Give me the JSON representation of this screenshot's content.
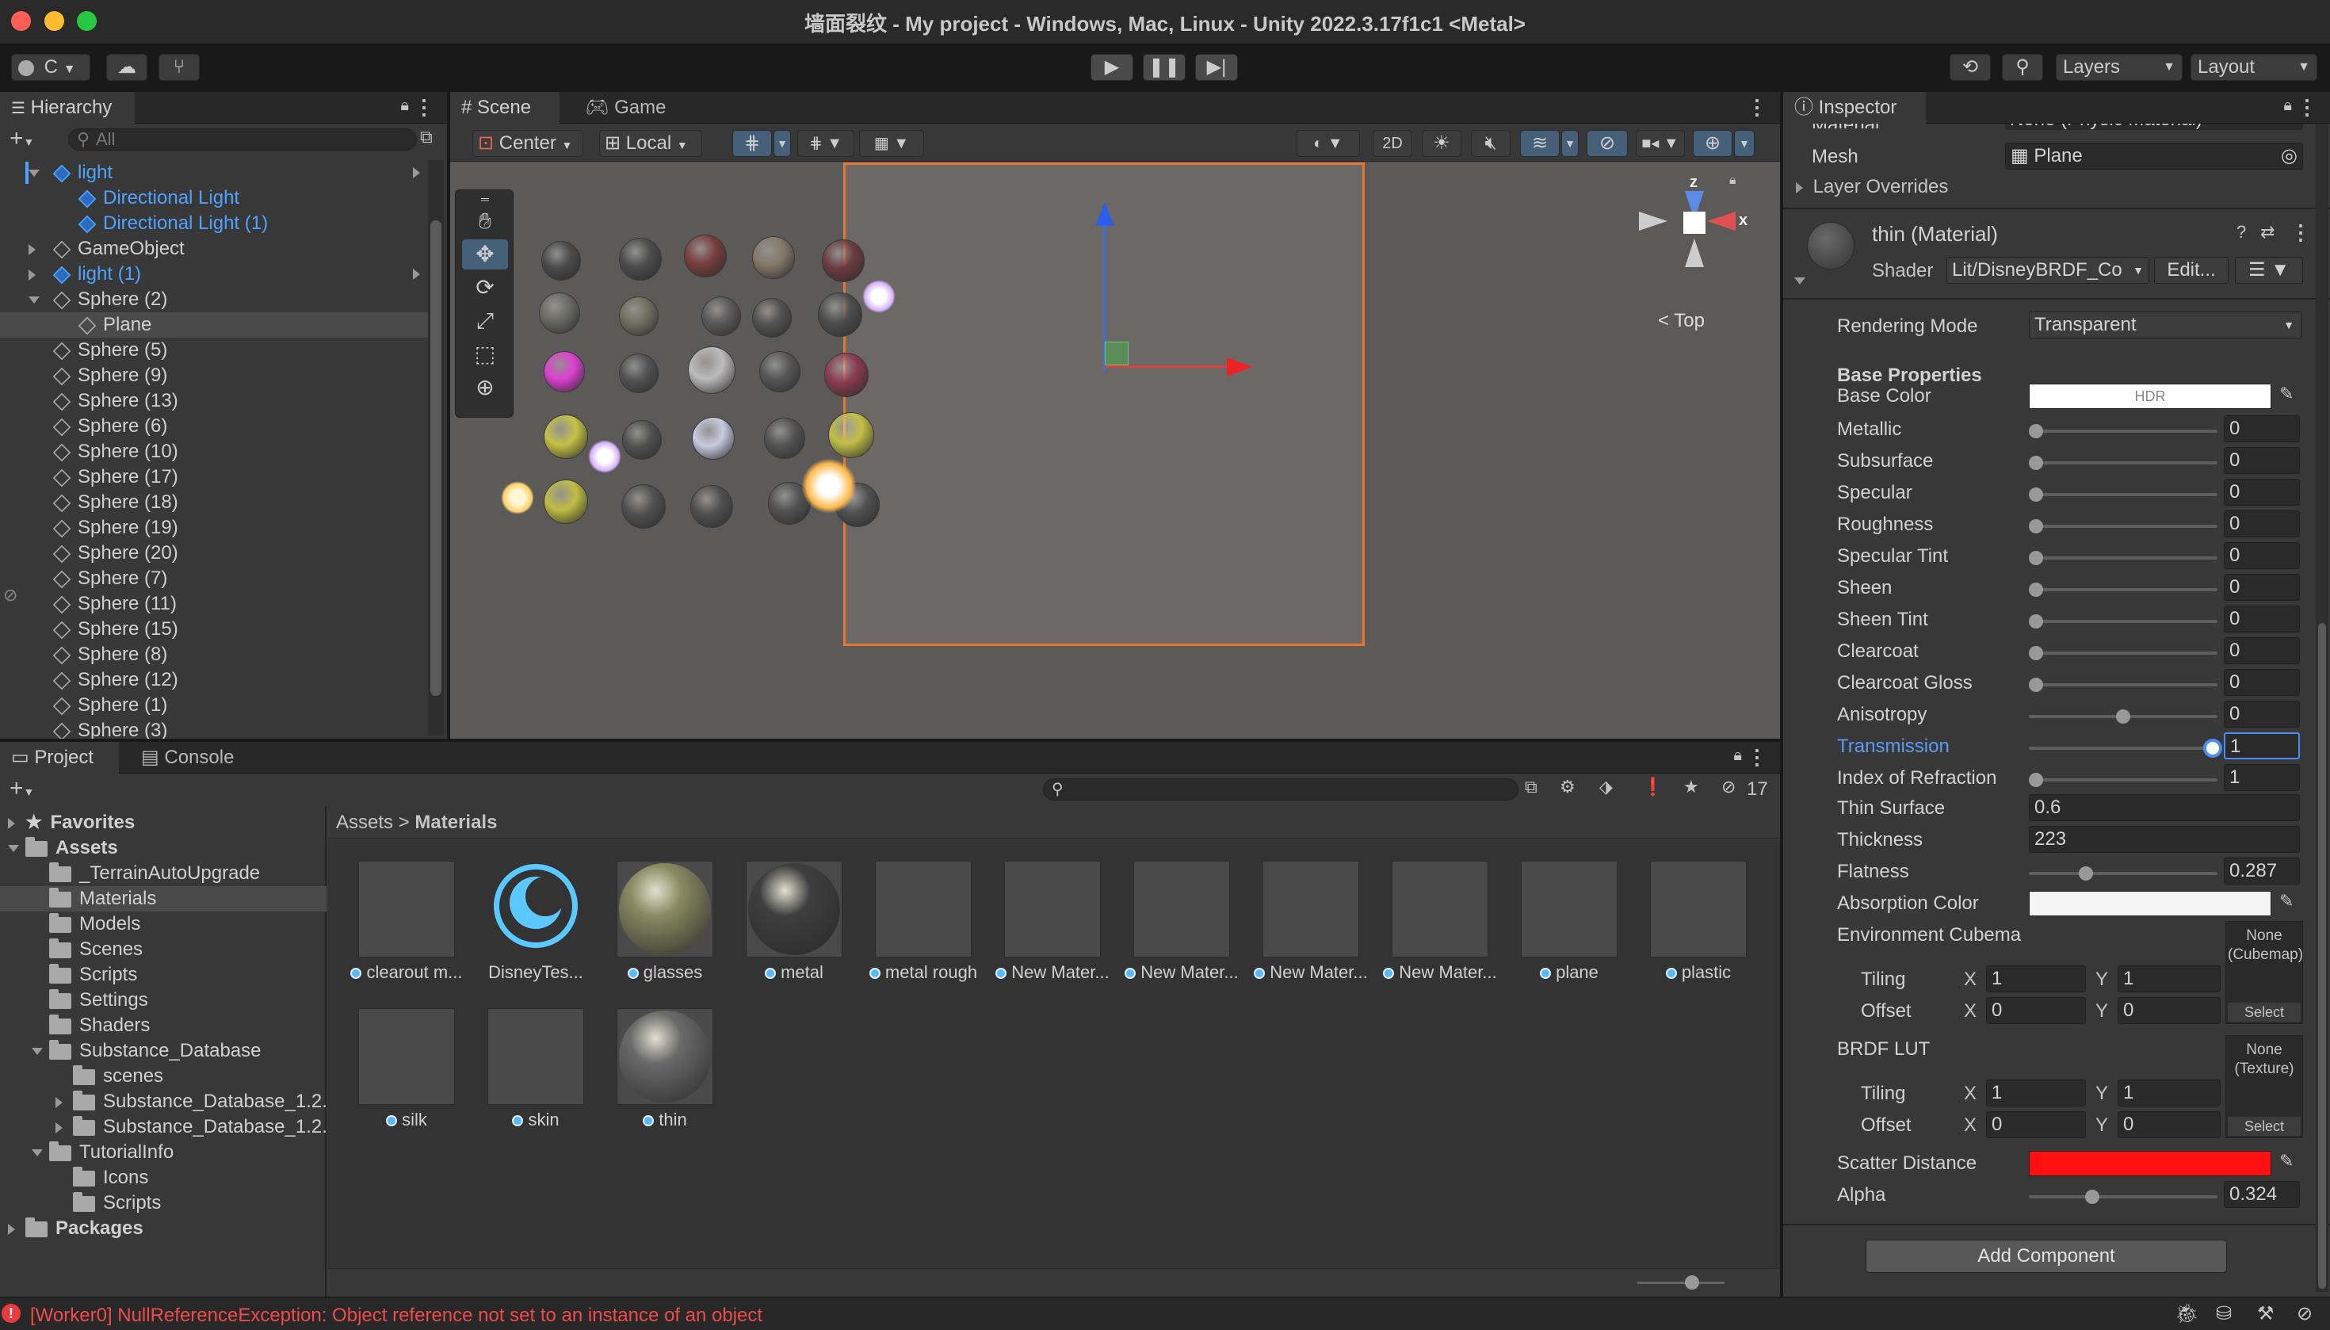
{
  "window": {
    "title": "墙面裂纹 - My project - Windows, Mac, Linux - Unity 2022.3.17f1c1 <Metal>"
  },
  "toolbar": {
    "account": "C",
    "layers": "Layers",
    "layout": "Layout"
  },
  "hierarchy": {
    "tab": "Hierarchy",
    "search_placeholder": "All",
    "items": [
      {
        "label": "light",
        "blue": true,
        "indent": 1,
        "arrow": "down"
      },
      {
        "label": "Directional Light",
        "blue": true,
        "indent": 2
      },
      {
        "label": "Directional Light (1)",
        "blue": true,
        "indent": 2
      },
      {
        "label": "GameObject",
        "blue": false,
        "indent": 1,
        "arrow": "right"
      },
      {
        "label": "light (1)",
        "blue": true,
        "indent": 1,
        "arrow": "right"
      },
      {
        "label": "Sphere (2)",
        "blue": false,
        "indent": 1,
        "arrow": "down"
      },
      {
        "label": "Plane",
        "blue": false,
        "indent": 2,
        "selected": true
      },
      {
        "label": "Sphere (5)",
        "indent": 1
      },
      {
        "label": "Sphere (9)",
        "indent": 1
      },
      {
        "label": "Sphere (13)",
        "indent": 1
      },
      {
        "label": "Sphere (6)",
        "indent": 1
      },
      {
        "label": "Sphere (10)",
        "indent": 1
      },
      {
        "label": "Sphere (17)",
        "indent": 1
      },
      {
        "label": "Sphere (18)",
        "indent": 1
      },
      {
        "label": "Sphere (19)",
        "indent": 1
      },
      {
        "label": "Sphere (20)",
        "indent": 1
      },
      {
        "label": "Sphere (7)",
        "indent": 1
      },
      {
        "label": "Sphere (11)",
        "indent": 1
      },
      {
        "label": "Sphere (15)",
        "indent": 1
      },
      {
        "label": "Sphere (8)",
        "indent": 1
      },
      {
        "label": "Sphere (12)",
        "indent": 1
      },
      {
        "label": "Sphere (1)",
        "indent": 1
      },
      {
        "label": "Sphere (3)",
        "indent": 1
      }
    ]
  },
  "scene": {
    "tabs": [
      "Scene",
      "Game"
    ],
    "pivot": "Center",
    "space": "Local",
    "mode_2d": "2D",
    "gizmo": {
      "axis_x": "x",
      "axis_z": "z",
      "view": "Top"
    }
  },
  "project": {
    "tabs": [
      "Project",
      "Console"
    ],
    "count": "17",
    "breadcrumb": [
      "Assets",
      "Materials"
    ],
    "tree": [
      {
        "label": "Favorites",
        "type": "star",
        "indent": 0,
        "bold": true
      },
      {
        "label": "Assets",
        "type": "folder",
        "indent": 0,
        "bold": true
      },
      {
        "label": "_TerrainAutoUpgrade",
        "type": "folder",
        "indent": 1
      },
      {
        "label": "Materials",
        "type": "folder",
        "indent": 1,
        "selected": true
      },
      {
        "label": "Models",
        "type": "folder",
        "indent": 1
      },
      {
        "label": "Scenes",
        "type": "folder",
        "indent": 1
      },
      {
        "label": "Scripts",
        "type": "folder",
        "indent": 1
      },
      {
        "label": "Settings",
        "type": "folder",
        "indent": 1
      },
      {
        "label": "Shaders",
        "type": "folder",
        "indent": 1
      },
      {
        "label": "Substance_Database",
        "type": "folder",
        "indent": 1
      },
      {
        "label": "scenes",
        "type": "folder",
        "indent": 2
      },
      {
        "label": "Substance_Database_1.2.",
        "type": "folder",
        "indent": 2
      },
      {
        "label": "Substance_Database_1.2.",
        "type": "folder",
        "indent": 2
      },
      {
        "label": "TutorialInfo",
        "type": "folder",
        "indent": 1
      },
      {
        "label": "Icons",
        "type": "folder",
        "indent": 2
      },
      {
        "label": "Scripts",
        "type": "folder",
        "indent": 2
      },
      {
        "label": "Packages",
        "type": "folder",
        "indent": 0,
        "bold": true
      }
    ],
    "assets": [
      {
        "label": "clearout m...",
        "kind": "mat"
      },
      {
        "label": "DisneyTes...",
        "kind": "shader"
      },
      {
        "label": "glasses",
        "kind": "glass"
      },
      {
        "label": "metal",
        "kind": "metal"
      },
      {
        "label": "metal rough",
        "kind": "mat"
      },
      {
        "label": "New Mater...",
        "kind": "mat"
      },
      {
        "label": "New Mater...",
        "kind": "mat"
      },
      {
        "label": "New Mater...",
        "kind": "mat"
      },
      {
        "label": "New Mater...",
        "kind": "mat"
      },
      {
        "label": "plane",
        "kind": "mat"
      },
      {
        "label": "plastic",
        "kind": "mat"
      },
      {
        "label": "silk",
        "kind": "mat"
      },
      {
        "label": "skin",
        "kind": "mat"
      },
      {
        "label": "thin",
        "kind": "thin"
      }
    ]
  },
  "inspector": {
    "tab": "Inspector",
    "material_row": {
      "label": "Material",
      "value": "None (Physic Material)"
    },
    "mesh_row": {
      "label": "Mesh",
      "value": "Plane"
    },
    "layer_overrides": "Layer Overrides",
    "material_name": "thin (Material)",
    "shader_label": "Shader",
    "shader_value": "Lit/DisneyBRDF_Co",
    "edit": "Edit...",
    "rendering_mode_label": "Rendering Mode",
    "rendering_mode": "Transparent",
    "base_properties": "Base Properties",
    "base_color": {
      "label": "Base Color",
      "value": "HDR"
    },
    "sliders": [
      {
        "label": "Metallic",
        "value": "0",
        "frac": 0
      },
      {
        "label": "Subsurface",
        "value": "0",
        "frac": 0
      },
      {
        "label": "Specular",
        "value": "0",
        "frac": 0
      },
      {
        "label": "Roughness",
        "value": "0",
        "frac": 0
      },
      {
        "label": "Specular Tint",
        "value": "0",
        "frac": 0
      },
      {
        "label": "Sheen",
        "value": "0",
        "frac": 0
      },
      {
        "label": "Sheen Tint",
        "value": "0",
        "frac": 0
      },
      {
        "label": "Clearcoat",
        "value": "0",
        "frac": 0
      },
      {
        "label": "Clearcoat Gloss",
        "value": "0",
        "frac": 0
      },
      {
        "label": "Anisotropy",
        "value": "0",
        "frac": 0.5
      },
      {
        "label": "Transmission",
        "value": "1",
        "frac": 1,
        "active": true
      },
      {
        "label": "Index of Refraction",
        "value": "1",
        "frac": 0
      }
    ],
    "thin_surface": {
      "label": "Thin Surface",
      "value": "0.6"
    },
    "thickness": {
      "label": "Thickness",
      "value": "223"
    },
    "flatness": {
      "label": "Flatness",
      "value": "0.287",
      "frac": 0.287
    },
    "absorption_color": "Absorption Color",
    "env_cubemap": {
      "label": "Environment Cubema",
      "slot": "None (Cubemap)",
      "select": "Select"
    },
    "tiling1": {
      "label": "Tiling",
      "x": "1",
      "y": "1"
    },
    "offset1": {
      "label": "Offset",
      "x": "0",
      "y": "0"
    },
    "brdf_lut": {
      "label": "BRDF LUT",
      "slot": "None (Texture)",
      "select": "Select"
    },
    "tiling2": {
      "label": "Tiling",
      "x": "1",
      "y": "1"
    },
    "offset2": {
      "label": "Offset",
      "x": "0",
      "y": "0"
    },
    "scatter_distance": {
      "label": "Scatter Distance",
      "color": "#ff1010"
    },
    "alpha": {
      "label": "Alpha",
      "value": "0.324",
      "frac": 0.324
    },
    "add_component": "Add Component",
    "xy": {
      "x": "X",
      "y": "Y"
    }
  },
  "status": {
    "error": "[Worker0] NullReferenceException: Object reference not set to an instance of an object"
  }
}
